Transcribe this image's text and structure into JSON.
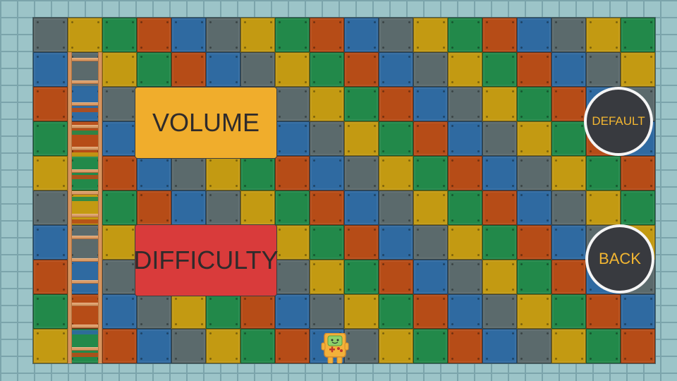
{
  "menu": {
    "volume_label": "VOLUME",
    "difficulty_label": "DIFFICULTY",
    "default_label": "DEFAULT",
    "back_label": "BACK"
  },
  "colors": {
    "blue": "#2f6aa1",
    "gray": "#5b6a6c",
    "green": "#22894a",
    "orange": "#b64c17",
    "yellow": "#c39a12",
    "volume_button": "#f0ad2c",
    "difficulty_button": "#d93b3b",
    "round_button_bg": "#383a3f",
    "round_button_text": "#f2b632"
  },
  "board": {
    "rows": [
      [
        "G",
        "Y",
        "N",
        "O",
        "B",
        "G",
        "Y",
        "N",
        "O",
        "B",
        "G",
        "Y",
        "N",
        "O",
        "B",
        "G",
        "Y",
        "N"
      ],
      [
        "B",
        "G",
        "Y",
        "N",
        "O",
        "B",
        "G",
        "Y",
        "N",
        "O",
        "B",
        "G",
        "Y",
        "N",
        "O",
        "B",
        "G",
        "Y"
      ],
      [
        "O",
        "B",
        "G",
        "Y",
        "N",
        "O",
        "B",
        "G",
        "Y",
        "N",
        "O",
        "B",
        "G",
        "Y",
        "N",
        "O",
        "B",
        "G"
      ],
      [
        "N",
        "O",
        "B",
        "G",
        "Y",
        "N",
        "O",
        "B",
        "G",
        "Y",
        "N",
        "O",
        "B",
        "G",
        "Y",
        "N",
        "O",
        "B"
      ],
      [
        "Y",
        "N",
        "O",
        "B",
        "G",
        "Y",
        "N",
        "O",
        "B",
        "G",
        "Y",
        "N",
        "O",
        "B",
        "G",
        "Y",
        "N",
        "O"
      ],
      [
        "G",
        "Y",
        "N",
        "O",
        "B",
        "G",
        "Y",
        "N",
        "O",
        "B",
        "G",
        "Y",
        "N",
        "O",
        "B",
        "G",
        "Y",
        "N"
      ],
      [
        "B",
        "G",
        "Y",
        "N",
        "O",
        "B",
        "G",
        "Y",
        "N",
        "O",
        "B",
        "G",
        "Y",
        "N",
        "O",
        "B",
        "G",
        "Y"
      ],
      [
        "O",
        "B",
        "G",
        "Y",
        "N",
        "O",
        "B",
        "G",
        "Y",
        "N",
        "O",
        "B",
        "G",
        "Y",
        "N",
        "O",
        "B",
        "G"
      ],
      [
        "N",
        "O",
        "B",
        "G",
        "Y",
        "N",
        "O",
        "B",
        "G",
        "Y",
        "N",
        "O",
        "B",
        "G",
        "Y",
        "N",
        "O",
        "B"
      ],
      [
        "Y",
        "N",
        "O",
        "B",
        "G",
        "Y",
        "N",
        "O",
        "B",
        "G",
        "Y",
        "N",
        "O",
        "B",
        "G",
        "Y",
        "N",
        "O"
      ]
    ]
  },
  "ladder": {
    "rung_colors": [
      "G",
      "B",
      "O",
      "N",
      "Y",
      "O",
      "N",
      "O",
      "G",
      "B",
      "B",
      "O",
      "B",
      "O"
    ]
  },
  "character": {
    "icon": "gamepad-character-icon"
  }
}
